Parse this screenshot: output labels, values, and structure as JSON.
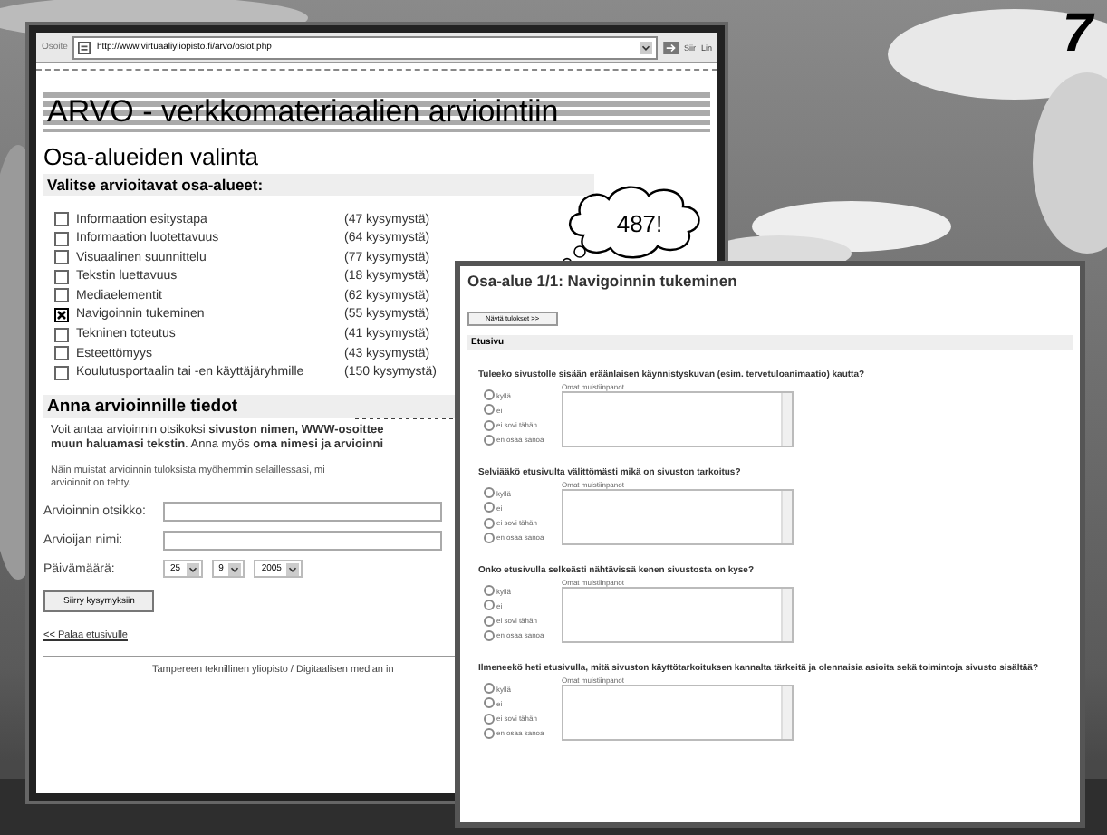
{
  "slide_number": "7",
  "browser": {
    "address_label": "Osoite",
    "url": "http://www.virtuaaliyliopisto.fi/arvo/osiot.php",
    "go_button": "Siir",
    "links_button": "Lin"
  },
  "page": {
    "title": "ARVO - verkkomateriaalien arviointiin",
    "heading": "Osa-alueiden valinta",
    "section": "Valitse arvioitavat osa-alueet:",
    "areas": [
      {
        "label": "Informaation esitystapa",
        "count": "(47 kysymystä)",
        "checked": false
      },
      {
        "label": "Informaation luotettavuus",
        "count": "(64 kysymystä)",
        "checked": false
      },
      {
        "label": "Visuaalinen suunnittelu",
        "count": "(77 kysymystä)",
        "checked": false
      },
      {
        "label": "Tekstin luettavuus",
        "count": "(18 kysymystä)",
        "checked": false
      },
      {
        "label": "Mediaelementit",
        "count": "(62 kysymystä)",
        "checked": false
      },
      {
        "label": "Navigoinnin tukeminen",
        "count": "(55 kysymystä)",
        "checked": true
      },
      {
        "label": "Tekninen toteutus",
        "count": "(41 kysymystä)",
        "checked": false
      },
      {
        "label": "Esteettömyys",
        "count": "(43 kysymystä)",
        "checked": false
      },
      {
        "label": "Koulutusportaalin tai -en käyttäjäryhmille",
        "count": "(150 kysymystä)",
        "checked": false
      }
    ],
    "info_heading": "Anna arvioinnille tiedot",
    "info_lines": [
      "Voit antaa arvioinnin otsikoksi **sivuston nimen, WWW-osoittee**",
      "**muun haluamasi tekstin**. Anna myös **oma nimesi ja arvioinni**"
    ],
    "note_lines": [
      "Näin muistat arvioinnin tuloksista myöhemmin selaillessasi, mi",
      "arvioinnit on tehty."
    ],
    "fields": [
      {
        "label": "Arvioinnin otsikko:"
      },
      {
        "label": "Arvioijan nimi:"
      }
    ],
    "date": {
      "label": "Päivämäärä:",
      "day": "25",
      "month": "9",
      "year": "2005"
    },
    "submit": "Siirry kysymyksiin",
    "back_link": "<< Palaa etusivulle",
    "footer": "Tampereen teknillinen yliopisto / Digitaalisen median in"
  },
  "callout": "487!",
  "questions_window": {
    "title": "Osa-alue 1/1: Navigoinnin tukeminen",
    "results_button": "Näytä tulokset >>",
    "section": "Etusivu",
    "questions": [
      {
        "text": "Tuleeko sivustolle sisään eräänlaisen käynnistyskuvan (esim. tervetuloanimaatio) kautta?",
        "notes_label": "Omat muistiinpanot",
        "options": [
          {
            "label": "kyllä",
            "selected": false
          },
          {
            "label": "ei",
            "selected": false
          },
          {
            "label": "ei sovi tähän",
            "selected": false
          },
          {
            "label": "en osaa sanoa",
            "selected": false
          }
        ]
      },
      {
        "text": "Selviääkö etusivulta välittömästi mikä on sivuston tarkoitus?",
        "notes_label": "Omat muistiinpanot",
        "options": [
          {
            "label": "kyllä",
            "selected": false
          },
          {
            "label": "ei",
            "selected": false
          },
          {
            "label": "ei sovi tähän",
            "selected": false
          },
          {
            "label": "en osaa sanoa",
            "selected": false
          }
        ]
      },
      {
        "text": "Onko etusivulla selkeästi nähtävissä kenen sivustosta on kyse?",
        "notes_label": "Omat muistiinpanot",
        "options": [
          {
            "label": "kyllä",
            "selected": false
          },
          {
            "label": "ei",
            "selected": false
          },
          {
            "label": "ei sovi tähän",
            "selected": false
          },
          {
            "label": "en osaa sanoa",
            "selected": false
          }
        ]
      },
      {
        "text": "Ilmeneekö heti etusivulla, mitä sivuston käyttötarkoituksen kannalta tärkeitä ja olennaisia asioita sekä toimintoja sivusto sisältää?",
        "notes_label": "Omat muistiinpanot",
        "options": [
          {
            "label": "kyllä",
            "selected": false
          },
          {
            "label": "ei",
            "selected": false
          },
          {
            "label": "ei sovi tähän",
            "selected": false
          },
          {
            "label": "en osaa sanoa",
            "selected": false
          }
        ]
      }
    ]
  }
}
